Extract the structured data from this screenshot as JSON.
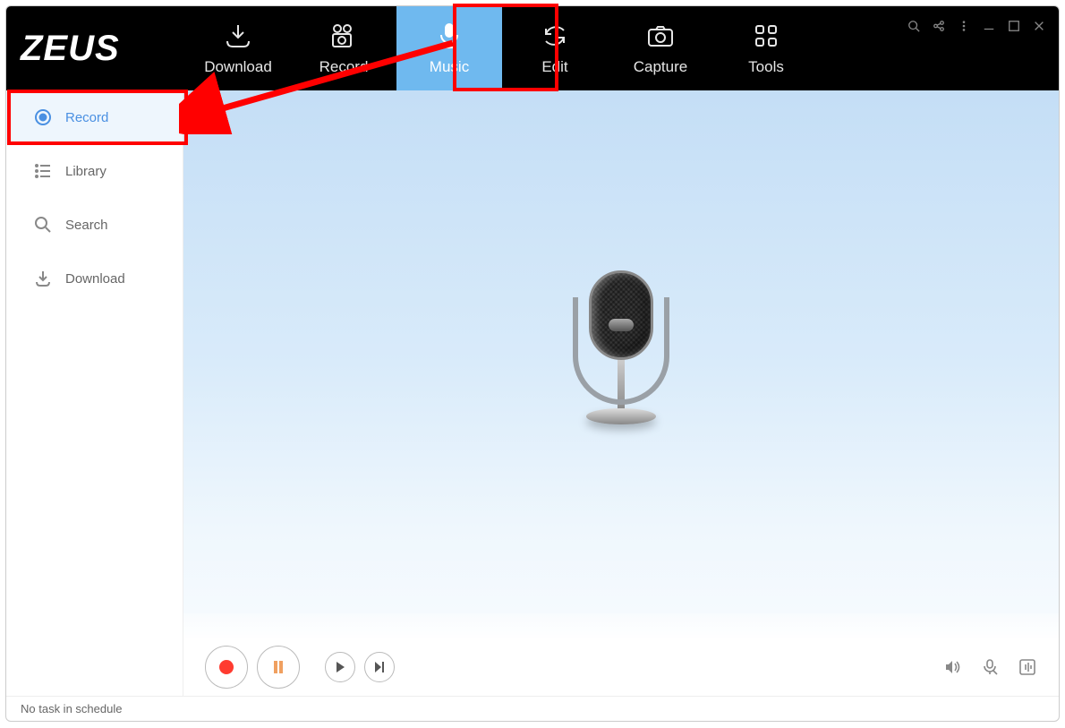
{
  "app": {
    "name": "ZEUS"
  },
  "tabs": {
    "download": "Download",
    "record": "Record",
    "music": "Music",
    "edit": "Edit",
    "capture": "Capture",
    "tools": "Tools"
  },
  "sidebar": {
    "record": "Record",
    "library": "Library",
    "search": "Search",
    "download": "Download"
  },
  "status": {
    "text": "No task in schedule"
  }
}
